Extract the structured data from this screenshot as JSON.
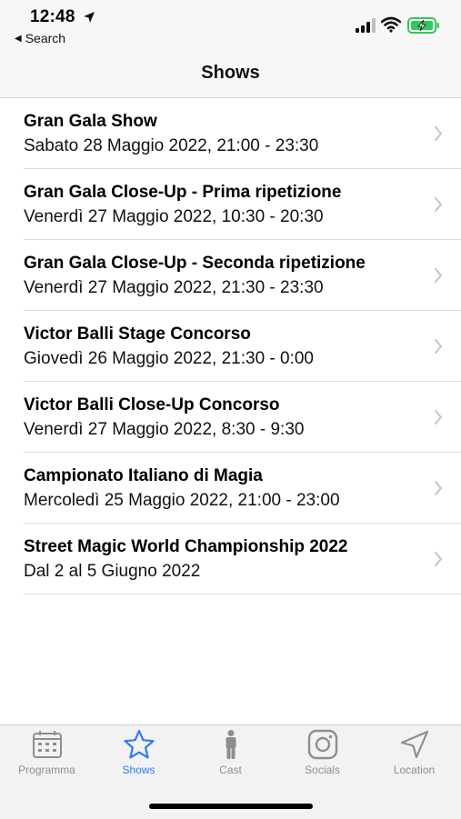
{
  "status_bar": {
    "time": "12:48",
    "back_label": "Search",
    "icons": [
      "location-arrow-icon",
      "signal-icon",
      "wifi-icon",
      "battery-charging-icon"
    ]
  },
  "nav": {
    "title": "Shows"
  },
  "shows": [
    {
      "title": "Gran Gala Show",
      "subtitle": "Sabato 28 Maggio 2022, 21:00 - 23:30"
    },
    {
      "title": "Gran Gala Close-Up - Prima ripetizione",
      "subtitle": "Venerdì 27 Maggio 2022, 10:30 - 20:30"
    },
    {
      "title": "Gran Gala Close-Up - Seconda ripetizione",
      "subtitle": "Venerdì 27 Maggio 2022, 21:30 - 23:30"
    },
    {
      "title": "Victor Balli Stage Concorso",
      "subtitle": "Giovedì 26 Maggio 2022, 21:30 - 0:00"
    },
    {
      "title": "Victor Balli Close-Up Concorso",
      "subtitle": "Venerdì 27 Maggio 2022, 8:30 - 9:30"
    },
    {
      "title": "Campionato Italiano di Magia",
      "subtitle": "Mercoledì 25 Maggio 2022, 21:00 - 23:00"
    },
    {
      "title": "Street Magic World Championship 2022",
      "subtitle": "Dal 2 al 5 Giugno 2022"
    }
  ],
  "tabs": [
    {
      "label": "Programma",
      "icon": "calendar-icon",
      "active": false
    },
    {
      "label": "Shows",
      "icon": "star-icon",
      "active": true
    },
    {
      "label": "Cast",
      "icon": "person-icon",
      "active": false
    },
    {
      "label": "Socials",
      "icon": "instagram-icon",
      "active": false
    },
    {
      "label": "Location",
      "icon": "location-arrow-icon",
      "active": false
    }
  ],
  "colors": {
    "accent": "#2f7bf5",
    "inactive": "#8e8e8e",
    "battery_green": "#34c759"
  }
}
